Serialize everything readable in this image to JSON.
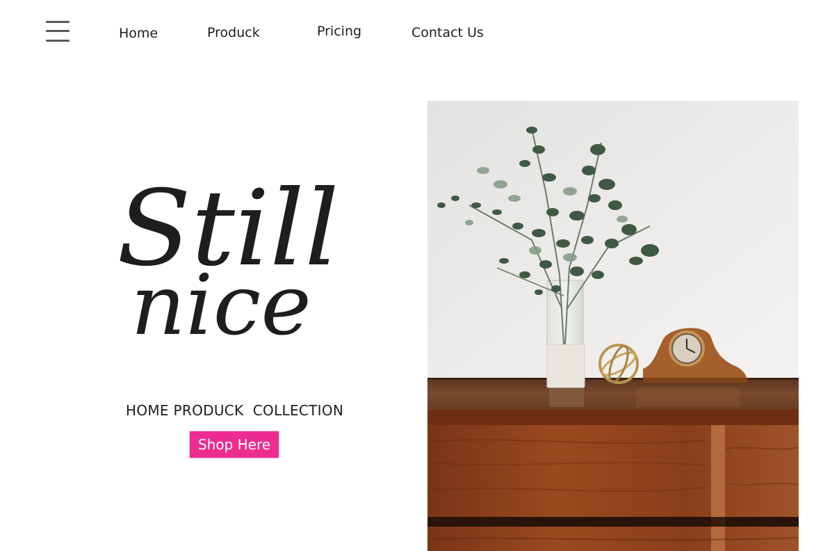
{
  "nav": {
    "home": "Home",
    "product": "Produck",
    "pricing": "Pricing",
    "contact": "Contact Us"
  },
  "icons": {
    "menu": "hamburger-menu-icon"
  },
  "hero": {
    "title_line1": "Still",
    "title_line2": "nice",
    "subtitle": "HOME PRODUCK  COLLECTION",
    "cta": "Shop Here"
  },
  "colors": {
    "accent": "#ee2c8f",
    "text": "#1d1d1d",
    "wood": "#8a3f1c",
    "wall": "#eceae8"
  }
}
